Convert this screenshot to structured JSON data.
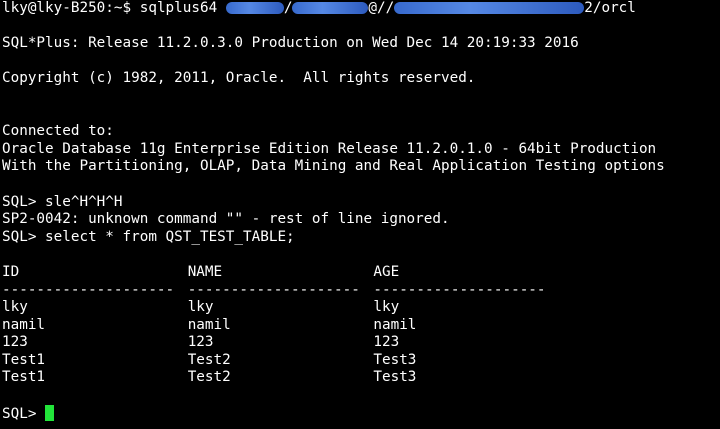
{
  "command": {
    "prompt": "lky@lky-B250:~$ ",
    "cmd": "sqlplus64 ",
    "slash1": "/",
    "at": "@//",
    "tail": "2/orcl"
  },
  "banner": {
    "release": "SQL*Plus: Release 11.2.0.3.0 Production on Wed Dec 14 20:19:33 2016",
    "copyright": "Copyright (c) 1982, 2011, Oracle.  All rights reserved."
  },
  "connection": {
    "connected": "Connected to:",
    "edition": "Oracle Database 11g Enterprise Edition Release 11.2.0.1.0 - 64bit Production",
    "options": "With the Partitioning, OLAP, Data Mining and Real Application Testing options"
  },
  "session": {
    "line1": "SQL> sle^H^H^H",
    "error": "SP2-0042: unknown command \"\" - rest of line ignored.",
    "query": "SQL> select * from QST_TEST_TABLE;"
  },
  "result": {
    "headers": [
      "ID",
      "NAME",
      "AGE"
    ],
    "separator": "--------------------",
    "rows": [
      [
        "lky",
        "lky",
        "lky"
      ],
      [
        "namil",
        "namil",
        "namil"
      ],
      [
        "123",
        "123",
        "123"
      ],
      [
        "Test1",
        "Test2",
        "Test3"
      ],
      [
        "Test1",
        "Test2",
        "Test3"
      ]
    ]
  },
  "final_prompt": "SQL> ",
  "colors": {
    "background": "#000000",
    "text": "#ffffff",
    "cursor": "#22e53a",
    "redaction": "#3a6fd8"
  }
}
